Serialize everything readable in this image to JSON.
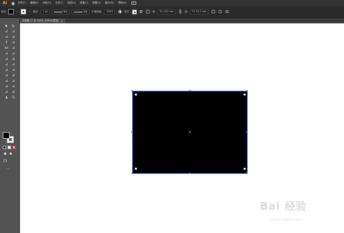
{
  "app": {
    "logo": "Ai"
  },
  "menu": [
    "文件(F)",
    "编辑(E)",
    "对象(O)",
    "文字(T)",
    "选择(S)",
    "效果(C)",
    "视图(V)",
    "窗口(W)",
    "帮助(H)"
  ],
  "control": {
    "selection_label": "矩形",
    "stroke_label": "描边:",
    "stroke_value": "1 pt",
    "profile_label": "等比",
    "brush_label": "基本",
    "opacity_label": "不透明度:",
    "opacity_value": "100%",
    "style_label": "样式:",
    "width_label": "宽:",
    "width_value": "51.152 mm",
    "height_label": "高:",
    "height_value": "37.53.2 mm"
  },
  "tab": {
    "title": "未标题-1* @ 300% (CMYK/预览)",
    "close": "×"
  },
  "watermark": {
    "brand": "Bai 经验",
    "url": "jingyan.baidu.com"
  },
  "colors": {
    "fill": "#000000",
    "stroke": "#ffffff",
    "selection": "#4a6ef0",
    "accent": "#ff9a00"
  },
  "tools": [
    "selection-tool",
    "direct-selection-tool",
    "magic-wand-tool",
    "lasso-tool",
    "pen-tool",
    "curvature-tool",
    "type-tool",
    "line-segment-tool",
    "rectangle-tool",
    "paintbrush-tool",
    "shaper-tool",
    "eraser-tool",
    "rotate-tool",
    "scale-tool",
    "width-tool",
    "free-transform-tool",
    "shape-builder-tool",
    "perspective-grid-tool",
    "mesh-tool",
    "gradient-tool",
    "eyedropper-tool",
    "blend-tool",
    "symbol-sprayer-tool",
    "column-graph-tool",
    "artboard-tool",
    "slice-tool",
    "hand-tool",
    "zoom-tool"
  ]
}
